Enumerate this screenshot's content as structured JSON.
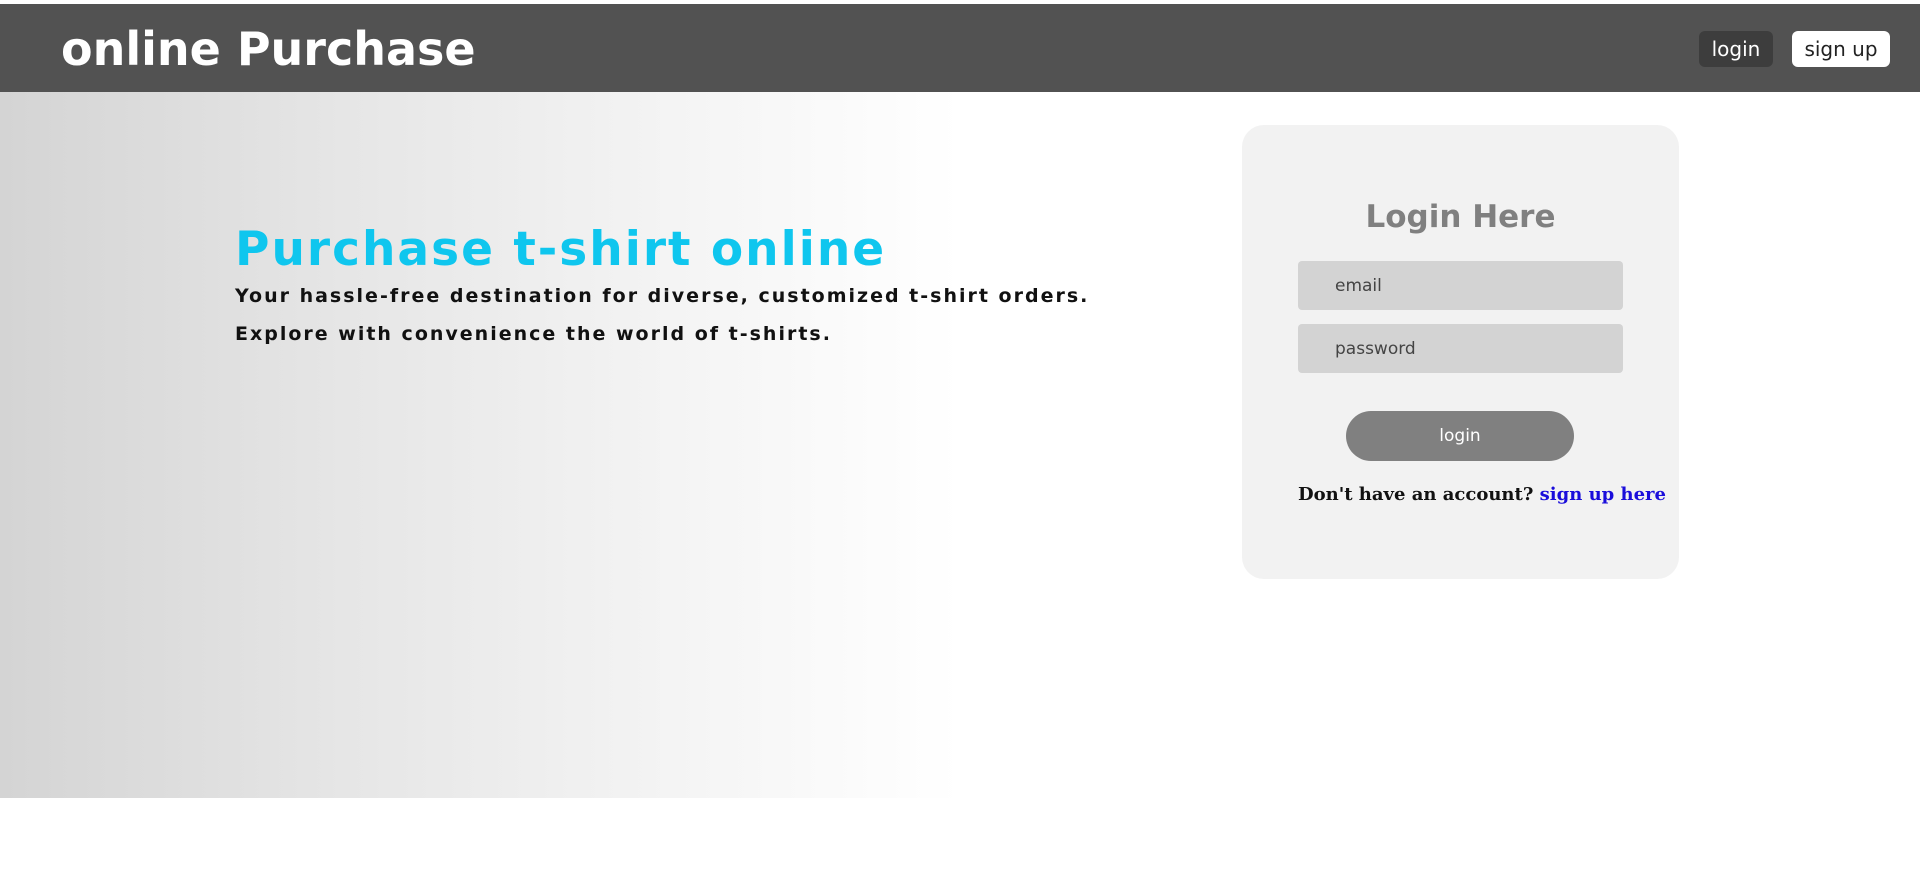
{
  "header": {
    "brand": "online Purchase",
    "login_label": "login",
    "signup_label": "sign up"
  },
  "hero": {
    "title": "Purchase t-shirt online",
    "line1": "Your hassle-free destination for diverse, customized t-shirt orders.",
    "line2": "Explore with convenience the world of t-shirts."
  },
  "login_card": {
    "title": "Login Here",
    "email_placeholder": "email",
    "password_placeholder": "password",
    "submit_label": "login",
    "prompt_text": "Don't have an account?",
    "signup_link": "sign up here"
  },
  "colors": {
    "navbar": "#525252",
    "accent_title": "#0fc6ee",
    "link": "#1a0ddb",
    "button": "#808080"
  }
}
